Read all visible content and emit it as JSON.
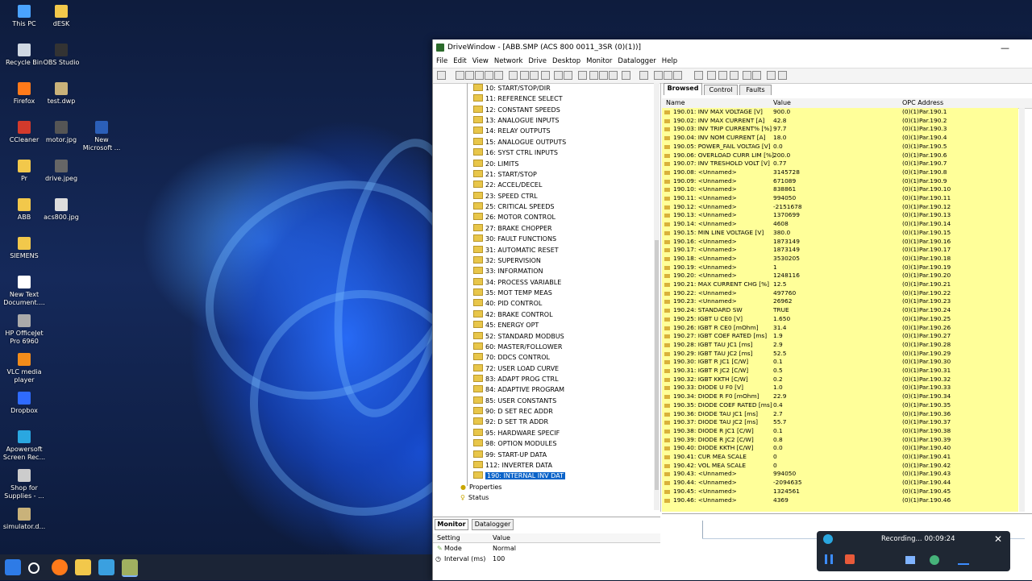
{
  "desktop": {
    "icons": [
      {
        "label": "This PC",
        "color": "#4aa3ff"
      },
      {
        "label": "dESK",
        "color": "#f2c84b"
      },
      {
        "label": "Recycle Bin",
        "color": "#cfd8e3"
      },
      {
        "label": "OBS Studio",
        "color": "#333333"
      },
      {
        "label": "Firefox",
        "color": "#ff7a1a"
      },
      {
        "label": "test.dwp",
        "color": "#c9b27a"
      },
      {
        "label": "CCleaner",
        "color": "#d33a2c"
      },
      {
        "label": "motor.jpg",
        "color": "#555555"
      },
      {
        "label": "New Microsoft ...",
        "color": "#2b5fb8"
      },
      {
        "label": "Pr",
        "color": "#f2c84b"
      },
      {
        "label": "drive.jpeg",
        "color": "#666666"
      },
      {
        "label": "ABB",
        "color": "#f2c84b"
      },
      {
        "label": "acs800.jpg",
        "color": "#dddddd"
      },
      {
        "label": "SIEMENS",
        "color": "#f2c84b"
      },
      {
        "label": "New Text Document....",
        "color": "#ffffff"
      },
      {
        "label": "HP OfficeJet Pro 6960",
        "color": "#aaaaaa"
      },
      {
        "label": "VLC media player",
        "color": "#f28c1a"
      },
      {
        "label": "Dropbox",
        "color": "#2f6bff"
      },
      {
        "label": "Apowersoft Screen Rec...",
        "color": "#2aa7e0"
      },
      {
        "label": "Shop for Supplies - ...",
        "color": "#cccccc"
      },
      {
        "label": "simulator.d...",
        "color": "#c9b27a"
      }
    ]
  },
  "window": {
    "title": "DriveWindow - [ABB.SMP (ACS 800 0011_3SR (0)(1))]",
    "menu": [
      "File",
      "Edit",
      "View",
      "Network",
      "Drive",
      "Desktop",
      "Monitor",
      "Datalogger",
      "Help"
    ],
    "controls": {
      "minimize": "—",
      "close": "✕"
    }
  },
  "tree": {
    "items": [
      "10: START/STOP/DIR",
      "11: REFERENCE SELECT",
      "12: CONSTANT SPEEDS",
      "13: ANALOGUE INPUTS",
      "14: RELAY OUTPUTS",
      "15: ANALOGUE OUTPUTS",
      "16: SYST CTRL INPUTS",
      "20: LIMITS",
      "21: START/STOP",
      "22: ACCEL/DECEL",
      "23: SPEED CTRL",
      "25: CRITICAL SPEEDS",
      "26: MOTOR CONTROL",
      "27: BRAKE CHOPPER",
      "30: FAULT FUNCTIONS",
      "31: AUTOMATIC RESET",
      "32: SUPERVISION",
      "33: INFORMATION",
      "34: PROCESS VARIABLE",
      "35: MOT TEMP MEAS",
      "40: PID CONTROL",
      "42: BRAKE CONTROL",
      "45: ENERGY OPT",
      "52: STANDARD MODBUS",
      "60: MASTER/FOLLOWER",
      "70: DDCS CONTROL",
      "72: USER LOAD CURVE",
      "83: ADAPT PROG CTRL",
      "84: ADAPTIVE PROGRAM",
      "85: USER CONSTANTS",
      "90: D SET REC ADDR",
      "92: D SET TR ADDR",
      "95: HARDWARE SPECIF",
      "98: OPTION MODULES",
      "99: START-UP DATA",
      "112: INVERTER DATA",
      "190: INTERNAL INV DAT"
    ],
    "selected_index": 36,
    "extra": [
      "Properties",
      "Status"
    ]
  },
  "right_panel": {
    "tabs": [
      "Browsed",
      "Control",
      "Faults"
    ],
    "columns": [
      "Name",
      "Value",
      "OPC Address"
    ],
    "rows": [
      [
        "190.01: INV MAX VOLTAGE [V]",
        "900.0",
        "(0)(1)Par.190.1"
      ],
      [
        "190.02: INV MAX CURRENT [A]",
        "42.8",
        "(0)(1)Par.190.2"
      ],
      [
        "190.03: INV TRIP CURRENT% [%]",
        "97.7",
        "(0)(1)Par.190.3"
      ],
      [
        "190.04: INV NOM CURRENT [A]",
        "18.0",
        "(0)(1)Par.190.4"
      ],
      [
        "190.05: POWER_FAIL VOLTAG [V]",
        "0.0",
        "(0)(1)Par.190.5"
      ],
      [
        "190.06: OVERLOAD CURR LIM [%]",
        "200.0",
        "(0)(1)Par.190.6"
      ],
      [
        "190.07: INV TRESHOLD VOLT [V]",
        "0.77",
        "(0)(1)Par.190.7"
      ],
      [
        "190.08: <Unnamed>",
        "3145728",
        "(0)(1)Par.190.8"
      ],
      [
        "190.09: <Unnamed>",
        "671089",
        "(0)(1)Par.190.9"
      ],
      [
        "190.10: <Unnamed>",
        "838861",
        "(0)(1)Par.190.10"
      ],
      [
        "190.11: <Unnamed>",
        "994050",
        "(0)(1)Par.190.11"
      ],
      [
        "190.12: <Unnamed>",
        "-2151678",
        "(0)(1)Par.190.12"
      ],
      [
        "190.13: <Unnamed>",
        "1370699",
        "(0)(1)Par.190.13"
      ],
      [
        "190.14: <Unnamed>",
        "4608",
        "(0)(1)Par.190.14"
      ],
      [
        "190.15: MIN LINE VOLTAGE [V]",
        "380.0",
        "(0)(1)Par.190.15"
      ],
      [
        "190.16: <Unnamed>",
        "1873149",
        "(0)(1)Par.190.16"
      ],
      [
        "190.17: <Unnamed>",
        "1873149",
        "(0)(1)Par.190.17"
      ],
      [
        "190.18: <Unnamed>",
        "3530205",
        "(0)(1)Par.190.18"
      ],
      [
        "190.19: <Unnamed>",
        "1",
        "(0)(1)Par.190.19"
      ],
      [
        "190.20: <Unnamed>",
        "1248116",
        "(0)(1)Par.190.20"
      ],
      [
        "190.21: MAX CURRENT CHG [%]",
        "12.5",
        "(0)(1)Par.190.21"
      ],
      [
        "190.22: <Unnamed>",
        "497760",
        "(0)(1)Par.190.22"
      ],
      [
        "190.23: <Unnamed>",
        "26962",
        "(0)(1)Par.190.23"
      ],
      [
        "190.24: STANDARD SW",
        "TRUE",
        "(0)(1)Par.190.24"
      ],
      [
        "190.25: IGBT U CE0 [V]",
        "1.650",
        "(0)(1)Par.190.25"
      ],
      [
        "190.26: IGBT R CE0 [mOhm]",
        "31.4",
        "(0)(1)Par.190.26"
      ],
      [
        "190.27: IGBT COEF RATED [ms]",
        "1.9",
        "(0)(1)Par.190.27"
      ],
      [
        "190.28: IGBT TAU JC1 [ms]",
        "2.9",
        "(0)(1)Par.190.28"
      ],
      [
        "190.29: IGBT TAU JC2 [ms]",
        "52.5",
        "(0)(1)Par.190.29"
      ],
      [
        "190.30: IGBT R JC1 [C/W]",
        "0.1",
        "(0)(1)Par.190.30"
      ],
      [
        "190.31: IGBT R JC2 [C/W]",
        "0.5",
        "(0)(1)Par.190.31"
      ],
      [
        "190.32: IGBT KKTH [C/W]",
        "0.2",
        "(0)(1)Par.190.32"
      ],
      [
        "190.33: DIODE U F0 [V]",
        "1.0",
        "(0)(1)Par.190.33"
      ],
      [
        "190.34: DIODE R F0 [mOhm]",
        "22.9",
        "(0)(1)Par.190.34"
      ],
      [
        "190.35: DIODE COEF RATED [ms]",
        "0.4",
        "(0)(1)Par.190.35"
      ],
      [
        "190.36: DIODE TAU JC1 [ms]",
        "2.7",
        "(0)(1)Par.190.36"
      ],
      [
        "190.37: DIODE TAU JC2 [ms]",
        "55.7",
        "(0)(1)Par.190.37"
      ],
      [
        "190.38: DIODE R JC1 [C/W]",
        "0.1",
        "(0)(1)Par.190.38"
      ],
      [
        "190.39: DIODE R JC2 [C/W]",
        "0.8",
        "(0)(1)Par.190.39"
      ],
      [
        "190.40: DIODE KKTH [C/W]",
        "0.0",
        "(0)(1)Par.190.40"
      ],
      [
        "190.41: CUR MEA SCALE",
        "0",
        "(0)(1)Par.190.41"
      ],
      [
        "190.42: VOL MEA SCALE",
        "0",
        "(0)(1)Par.190.42"
      ],
      [
        "190.43: <Unnamed>",
        "994050",
        "(0)(1)Par.190.43"
      ],
      [
        "190.44: <Unnamed>",
        "-2094635",
        "(0)(1)Par.190.44"
      ],
      [
        "190.45: <Unnamed>",
        "1324561",
        "(0)(1)Par.190.45"
      ],
      [
        "190.46: <Unnamed>",
        "4369",
        "(0)(1)Par.190.46"
      ]
    ]
  },
  "monitor": {
    "tabs": [
      "Monitor",
      "Datalogger"
    ],
    "columns": [
      "Setting",
      "Value"
    ],
    "settings": [
      {
        "name": "Mode",
        "value": "Normal"
      },
      {
        "name": "Interval (ms)",
        "value": "100"
      }
    ]
  },
  "recording": {
    "status": "Recording... 00:09:24",
    "close": "✕"
  },
  "colors": {
    "grid_bg": "#ffff99",
    "selection": "#0a63c9",
    "taskbar": "#1b2436"
  }
}
